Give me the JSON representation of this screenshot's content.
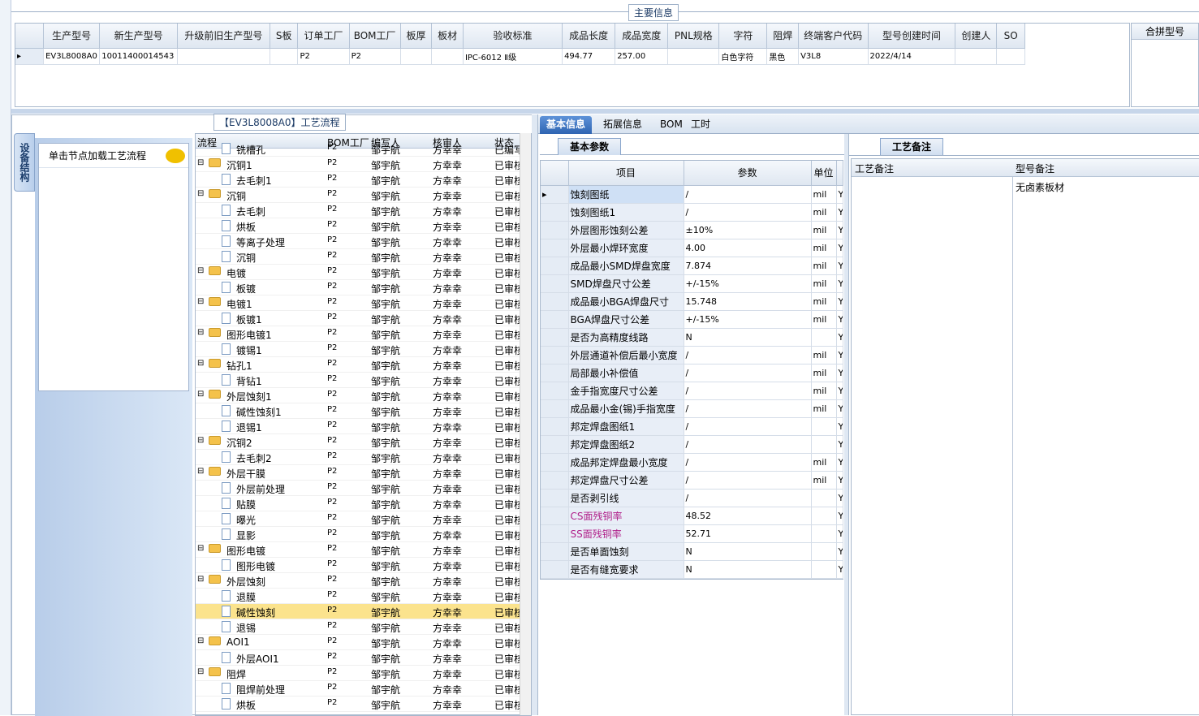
{
  "main_info": {
    "legend": "主要信息",
    "columns": [
      "生产型号",
      "新生产型号",
      "升级前旧生产型号",
      "S板",
      "订单工厂",
      "BOM工厂",
      "板厚",
      "板材",
      "验收标准",
      "成品长度",
      "成品宽度",
      "PNL规格",
      "字符",
      "阻焊",
      "终端客户代码",
      "型号创建时间",
      "创建人",
      "SO"
    ],
    "row": [
      "EV3L8008A0",
      "10011400014543",
      "",
      "",
      "P2",
      "P2",
      "",
      "",
      "IPC-6012 Ⅱ级",
      "494.77",
      "257.00",
      "",
      "白色字符",
      "黑色",
      "V3L8",
      "2022/4/14",
      "",
      ""
    ],
    "merge_header": "合拼型号"
  },
  "left": {
    "legend": "【EV3L8008A0】工艺流程",
    "vertical_tab": "设备结构",
    "device_item": "单击节点加载工艺流程",
    "flow_headers": [
      "流程",
      "BOM工厂",
      "编写人",
      "核审人",
      "状态"
    ],
    "flow_rows": [
      {
        "name": "铣槽孔",
        "type": "doc",
        "level": 2,
        "bom": "P2",
        "writer": "邹宇航",
        "reviewer": "方幸幸",
        "status": "已编写"
      },
      {
        "name": "沉铜1",
        "type": "folder",
        "level": 1,
        "bom": "P2",
        "writer": "邹宇航",
        "reviewer": "方幸幸",
        "status": "已审核"
      },
      {
        "name": "去毛刺1",
        "type": "doc",
        "level": 2,
        "bom": "P2",
        "writer": "邹宇航",
        "reviewer": "方幸幸",
        "status": "已审核"
      },
      {
        "name": "沉铜",
        "type": "folder",
        "level": 1,
        "bom": "P2",
        "writer": "邹宇航",
        "reviewer": "方幸幸",
        "status": "已审核"
      },
      {
        "name": "去毛刺",
        "type": "doc",
        "level": 2,
        "bom": "P2",
        "writer": "邹宇航",
        "reviewer": "方幸幸",
        "status": "已审核"
      },
      {
        "name": "烘板",
        "type": "doc",
        "level": 2,
        "bom": "P2",
        "writer": "邹宇航",
        "reviewer": "方幸幸",
        "status": "已审核"
      },
      {
        "name": "等离子处理",
        "type": "doc",
        "level": 2,
        "bom": "P2",
        "writer": "邹宇航",
        "reviewer": "方幸幸",
        "status": "已审核"
      },
      {
        "name": "沉铜",
        "type": "doc",
        "level": 2,
        "bom": "P2",
        "writer": "邹宇航",
        "reviewer": "方幸幸",
        "status": "已审核"
      },
      {
        "name": "电镀",
        "type": "folder",
        "level": 1,
        "bom": "P2",
        "writer": "邹宇航",
        "reviewer": "方幸幸",
        "status": "已审核"
      },
      {
        "name": "板镀",
        "type": "doc",
        "level": 2,
        "bom": "P2",
        "writer": "邹宇航",
        "reviewer": "方幸幸",
        "status": "已审核"
      },
      {
        "name": "电镀1",
        "type": "folder",
        "level": 1,
        "bom": "P2",
        "writer": "邹宇航",
        "reviewer": "方幸幸",
        "status": "已审核"
      },
      {
        "name": "板镀1",
        "type": "doc",
        "level": 2,
        "bom": "P2",
        "writer": "邹宇航",
        "reviewer": "方幸幸",
        "status": "已审核"
      },
      {
        "name": "图形电镀1",
        "type": "folder",
        "level": 1,
        "bom": "P2",
        "writer": "邹宇航",
        "reviewer": "方幸幸",
        "status": "已审核"
      },
      {
        "name": "镀锡1",
        "type": "doc",
        "level": 2,
        "bom": "P2",
        "writer": "邹宇航",
        "reviewer": "方幸幸",
        "status": "已审核"
      },
      {
        "name": "钻孔1",
        "type": "folder",
        "level": 1,
        "bom": "P2",
        "writer": "邹宇航",
        "reviewer": "方幸幸",
        "status": "已审核"
      },
      {
        "name": "背钻1",
        "type": "doc",
        "level": 2,
        "bom": "P2",
        "writer": "邹宇航",
        "reviewer": "方幸幸",
        "status": "已审核"
      },
      {
        "name": "外层蚀刻1",
        "type": "folder",
        "level": 1,
        "bom": "P2",
        "writer": "邹宇航",
        "reviewer": "方幸幸",
        "status": "已审核"
      },
      {
        "name": "碱性蚀刻1",
        "type": "doc",
        "level": 2,
        "bom": "P2",
        "writer": "邹宇航",
        "reviewer": "方幸幸",
        "status": "已审核"
      },
      {
        "name": "退锡1",
        "type": "doc",
        "level": 2,
        "bom": "P2",
        "writer": "邹宇航",
        "reviewer": "方幸幸",
        "status": "已审核"
      },
      {
        "name": "沉铜2",
        "type": "folder",
        "level": 1,
        "bom": "P2",
        "writer": "邹宇航",
        "reviewer": "方幸幸",
        "status": "已审核"
      },
      {
        "name": "去毛刺2",
        "type": "doc",
        "level": 2,
        "bom": "P2",
        "writer": "邹宇航",
        "reviewer": "方幸幸",
        "status": "已审核"
      },
      {
        "name": "外层干膜",
        "type": "folder",
        "level": 1,
        "bom": "P2",
        "writer": "邹宇航",
        "reviewer": "方幸幸",
        "status": "已审核"
      },
      {
        "name": "外层前处理",
        "type": "doc",
        "level": 2,
        "bom": "P2",
        "writer": "邹宇航",
        "reviewer": "方幸幸",
        "status": "已审核"
      },
      {
        "name": "贴膜",
        "type": "doc",
        "level": 2,
        "bom": "P2",
        "writer": "邹宇航",
        "reviewer": "方幸幸",
        "status": "已审核"
      },
      {
        "name": "曝光",
        "type": "doc",
        "level": 2,
        "bom": "P2",
        "writer": "邹宇航",
        "reviewer": "方幸幸",
        "status": "已审核"
      },
      {
        "name": "显影",
        "type": "doc",
        "level": 2,
        "bom": "P2",
        "writer": "邹宇航",
        "reviewer": "方幸幸",
        "status": "已审核"
      },
      {
        "name": "图形电镀",
        "type": "folder",
        "level": 1,
        "bom": "P2",
        "writer": "邹宇航",
        "reviewer": "方幸幸",
        "status": "已审核"
      },
      {
        "name": "图形电镀",
        "type": "doc",
        "level": 2,
        "bom": "P2",
        "writer": "邹宇航",
        "reviewer": "方幸幸",
        "status": "已审核"
      },
      {
        "name": "外层蚀刻",
        "type": "folder",
        "level": 1,
        "bom": "P2",
        "writer": "邹宇航",
        "reviewer": "方幸幸",
        "status": "已审核"
      },
      {
        "name": "退膜",
        "type": "doc",
        "level": 2,
        "bom": "P2",
        "writer": "邹宇航",
        "reviewer": "方幸幸",
        "status": "已审核"
      },
      {
        "name": "碱性蚀刻",
        "type": "doc",
        "level": 2,
        "bom": "P2",
        "writer": "邹宇航",
        "reviewer": "方幸幸",
        "status": "已审核",
        "selected": true
      },
      {
        "name": "退锡",
        "type": "doc",
        "level": 2,
        "bom": "P2",
        "writer": "邹宇航",
        "reviewer": "方幸幸",
        "status": "已审核"
      },
      {
        "name": "AOI1",
        "type": "folder",
        "level": 1,
        "bom": "P2",
        "writer": "邹宇航",
        "reviewer": "方幸幸",
        "status": "已审核"
      },
      {
        "name": "外层AOI1",
        "type": "doc",
        "level": 2,
        "bom": "P2",
        "writer": "邹宇航",
        "reviewer": "方幸幸",
        "status": "已审核"
      },
      {
        "name": "阻焊",
        "type": "folder",
        "level": 1,
        "bom": "P2",
        "writer": "邹宇航",
        "reviewer": "方幸幸",
        "status": "已审核"
      },
      {
        "name": "阻焊前处理",
        "type": "doc",
        "level": 2,
        "bom": "P2",
        "writer": "邹宇航",
        "reviewer": "方幸幸",
        "status": "已审核"
      },
      {
        "name": "烘板",
        "type": "doc",
        "level": 2,
        "bom": "P2",
        "writer": "邹宇航",
        "reviewer": "方幸幸",
        "status": "已审核"
      }
    ]
  },
  "tabs": [
    "基本信息",
    "拓展信息",
    "BOM",
    "工时"
  ],
  "params": {
    "subtab": "基本参数",
    "headers": [
      "项目",
      "参数",
      "单位"
    ],
    "rows": [
      {
        "item": "蚀刻图纸",
        "value": "/",
        "unit": "mil",
        "flag": "Y"
      },
      {
        "item": "蚀刻图纸1",
        "value": "/",
        "unit": "mil",
        "flag": "Y"
      },
      {
        "item": "外层图形蚀刻公差",
        "value": "±10%",
        "unit": "mil",
        "flag": "Y"
      },
      {
        "item": "外层最小焊环宽度",
        "value": "4.00",
        "unit": "mil",
        "flag": "Y"
      },
      {
        "item": "成品最小SMD焊盘宽度",
        "value": "7.874",
        "unit": "mil",
        "flag": "Y"
      },
      {
        "item": "SMD焊盘尺寸公差",
        "value": "+/-15%",
        "unit": "mil",
        "flag": "Y"
      },
      {
        "item": "成品最小BGA焊盘尺寸",
        "value": "15.748",
        "unit": "mil",
        "flag": "Y"
      },
      {
        "item": "BGA焊盘尺寸公差",
        "value": "+/-15%",
        "unit": "mil",
        "flag": "Y"
      },
      {
        "item": "是否为高精度线路",
        "value": "N",
        "unit": "",
        "flag": "Y"
      },
      {
        "item": "外层通道补偿后最小宽度",
        "value": "/",
        "unit": "mil",
        "flag": "Y"
      },
      {
        "item": "局部最小补偿值",
        "value": "/",
        "unit": "mil",
        "flag": "Y"
      },
      {
        "item": "金手指宽度尺寸公差",
        "value": "/",
        "unit": "mil",
        "flag": "Y"
      },
      {
        "item": "成品最小金(锡)手指宽度",
        "value": "/",
        "unit": "mil",
        "flag": "Y"
      },
      {
        "item": "邦定焊盘图纸1",
        "value": "/",
        "unit": "",
        "flag": "Y"
      },
      {
        "item": "邦定焊盘图纸2",
        "value": "/",
        "unit": "",
        "flag": "Y"
      },
      {
        "item": "成品邦定焊盘最小宽度",
        "value": "/",
        "unit": "mil",
        "flag": "Y"
      },
      {
        "item": "邦定焊盘尺寸公差",
        "value": "/",
        "unit": "mil",
        "flag": "Y"
      },
      {
        "item": "是否剥引线",
        "value": "/",
        "unit": "",
        "flag": "Y"
      },
      {
        "item": "CS面残铜率",
        "value": "48.52",
        "unit": "",
        "flag": "Y",
        "highlight": true
      },
      {
        "item": "SS面残铜率",
        "value": "52.71",
        "unit": "",
        "flag": "Y",
        "highlight": true
      },
      {
        "item": "是否单面蚀刻",
        "value": "N",
        "unit": "",
        "flag": "Y"
      },
      {
        "item": "是否有缝宽要求",
        "value": "N",
        "unit": "",
        "flag": "Y"
      }
    ]
  },
  "remarks": {
    "subtab": "工艺备注",
    "headers": [
      "工艺备注",
      "型号备注"
    ],
    "model_remark": "无卤素板材"
  },
  "colors": {
    "highlight_text": "#b0208a",
    "selected_row": "#fbe38d",
    "tab_active": "#2e64b2"
  }
}
